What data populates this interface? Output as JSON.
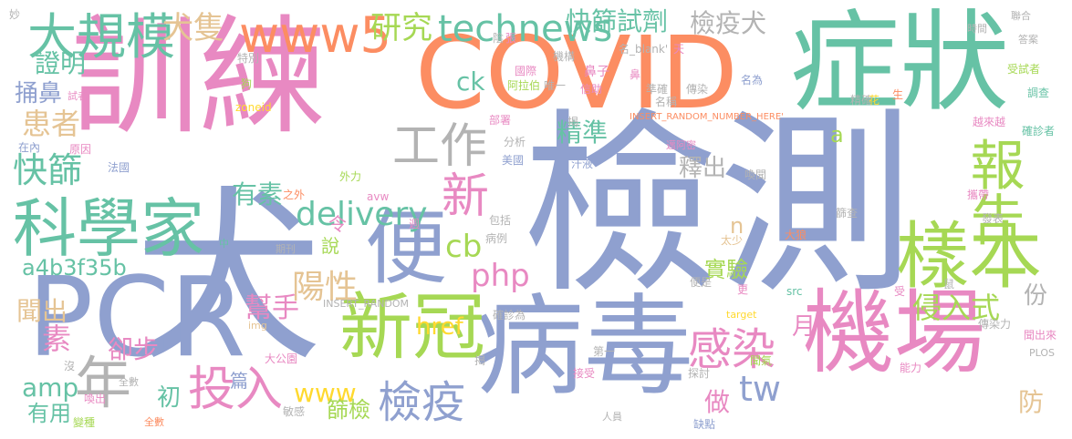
{
  "palette": {
    "pink": "#e889c2",
    "blue": "#8fa0cf",
    "orange": "#fc8d62",
    "green": "#66c2a5",
    "lime": "#a6d854",
    "yellow": "#ffd92f",
    "tan": "#e5c494",
    "gray": "#b3b3b3"
  },
  "words": [
    {
      "text": "檢測",
      "color": "blue"
    },
    {
      "text": "訓練",
      "color": "pink"
    },
    {
      "text": "犬",
      "color": "blue"
    },
    {
      "text": "COVID",
      "color": "orange"
    },
    {
      "text": "症狀",
      "color": "green"
    },
    {
      "text": "病毒",
      "color": "blue"
    },
    {
      "text": "機場",
      "color": "pink"
    },
    {
      "text": "PCR",
      "color": "blue"
    },
    {
      "text": "報告",
      "color": "lime"
    },
    {
      "text": "樣本",
      "color": "lime"
    },
    {
      "text": "科學家",
      "color": "green"
    },
    {
      "text": "便",
      "color": "blue"
    },
    {
      "text": "新冠",
      "color": "lime"
    },
    {
      "text": "大規模",
      "color": "green"
    },
    {
      "text": "www5",
      "color": "orange"
    },
    {
      "text": "工作",
      "color": "gray"
    },
    {
      "text": "年",
      "color": "gray"
    },
    {
      "text": "投入",
      "color": "pink"
    },
    {
      "text": "technews",
      "color": "green"
    },
    {
      "text": "研究",
      "color": "lime"
    },
    {
      "text": "快篩試劑",
      "color": "green"
    },
    {
      "text": "犬隻",
      "color": "tan"
    },
    {
      "text": "檢疫犬",
      "color": "gray"
    },
    {
      "text": "感染",
      "color": "pink"
    },
    {
      "text": "檢疫",
      "color": "blue"
    },
    {
      "text": "delivery",
      "color": "green"
    },
    {
      "text": "新",
      "color": "pink"
    },
    {
      "text": "php",
      "color": "pink"
    },
    {
      "text": "陽性",
      "color": "tan"
    },
    {
      "text": "快篩",
      "color": "green"
    },
    {
      "text": "患者",
      "color": "tan"
    },
    {
      "text": "證明",
      "color": "green"
    },
    {
      "text": "捅鼻",
      "color": "blue"
    },
    {
      "text": "ck",
      "color": "green"
    },
    {
      "text": "cb",
      "color": "lime"
    },
    {
      "text": "精準",
      "color": "green"
    },
    {
      "text": "釋出",
      "color": "gray"
    },
    {
      "text": "有素",
      "color": "green"
    },
    {
      "text": "a4b3f35b",
      "color": "green"
    },
    {
      "text": "amp",
      "color": "green"
    },
    {
      "text": "www",
      "color": "yellow"
    },
    {
      "text": "篩檢",
      "color": "lime"
    },
    {
      "text": "tw",
      "color": "blue"
    },
    {
      "text": "做",
      "color": "pink"
    },
    {
      "text": "侵入式",
      "color": "lime"
    },
    {
      "text": "實驗",
      "color": "lime"
    },
    {
      "text": "href",
      "color": "yellow"
    },
    {
      "text": "幫手",
      "color": "pink"
    },
    {
      "text": "聞出",
      "color": "tan"
    },
    {
      "text": "素",
      "color": "pink"
    },
    {
      "text": "卻步",
      "color": "pink"
    },
    {
      "text": "初",
      "color": "green"
    },
    {
      "text": "有用",
      "color": "green"
    },
    {
      "text": "月",
      "color": "pink"
    },
    {
      "text": "份",
      "color": "gray"
    },
    {
      "text": "說",
      "color": "lime"
    },
    {
      "text": "令",
      "color": "pink"
    },
    {
      "text": "n",
      "color": "tan"
    },
    {
      "text": "篇",
      "color": "blue"
    },
    {
      "text": "防",
      "color": "tan"
    },
    {
      "text": "a",
      "color": "lime"
    },
    {
      "text": "鼻子",
      "color": "pink"
    },
    {
      "text": "國際",
      "color": "pink"
    },
    {
      "text": "阿拉伯",
      "color": "lime"
    },
    {
      "text": "信助",
      "color": "pink"
    },
    {
      "text": "唯一",
      "color": "gray"
    },
    {
      "text": "名_blank'",
      "color": "gray"
    },
    {
      "text": "機構",
      "color": "gray"
    },
    {
      "text": "特別",
      "color": "gray"
    },
    {
      "text": "狗",
      "color": "lime"
    },
    {
      "text": "試者",
      "color": "pink"
    },
    {
      "text": "zoneid",
      "color": "yellow"
    },
    {
      "text": "在內",
      "color": "blue"
    },
    {
      "text": "原因",
      "color": "pink"
    },
    {
      "text": "法國",
      "color": "blue"
    },
    {
      "text": "部署",
      "color": "pink"
    },
    {
      "text": "分析",
      "color": "gray"
    },
    {
      "text": "美國",
      "color": "blue"
    },
    {
      "text": "汗液",
      "color": "blue"
    },
    {
      "text": "INSERT_RANDOM_NUMBER_HERE'",
      "color": "orange"
    },
    {
      "text": "邁阿密",
      "color": "pink"
    },
    {
      "text": "外力",
      "color": "lime"
    },
    {
      "text": "之外",
      "color": "orange"
    },
    {
      "text": "avw",
      "color": "pink"
    },
    {
      "text": "全數",
      "color": "gray"
    },
    {
      "text": "包括",
      "color": "gray"
    },
    {
      "text": "中",
      "color": "green"
    },
    {
      "text": "週",
      "color": "pink"
    },
    {
      "text": "期刊",
      "color": "gray"
    },
    {
      "text": "INSERT_RANDOM",
      "color": "gray"
    },
    {
      "text": "病例",
      "color": "gray"
    },
    {
      "text": "太少",
      "color": "tan"
    },
    {
      "text": "img",
      "color": "tan"
    },
    {
      "text": "確診為",
      "color": "gray"
    },
    {
      "text": "揭",
      "color": "gray"
    },
    {
      "text": "大公園",
      "color": "pink"
    },
    {
      "text": "沒",
      "color": "gray"
    },
    {
      "text": "第一",
      "color": "gray"
    },
    {
      "text": "接受",
      "color": "pink"
    },
    {
      "text": "喚出",
      "color": "pink"
    },
    {
      "text": "變種",
      "color": "lime"
    },
    {
      "text": "全數",
      "color": "orange"
    },
    {
      "text": "敏感",
      "color": "gray"
    },
    {
      "text": "人員",
      "color": "gray"
    },
    {
      "text": "時間",
      "color": "gray"
    },
    {
      "text": "聯合",
      "color": "gray"
    },
    {
      "text": "答案",
      "color": "gray"
    },
    {
      "text": "受試者",
      "color": "lime"
    },
    {
      "text": "調查",
      "color": "green"
    },
    {
      "text": "名為",
      "color": "blue"
    },
    {
      "text": "傳染",
      "color": "gray"
    },
    {
      "text": "準確",
      "color": "gray"
    },
    {
      "text": "精確",
      "color": "gray"
    },
    {
      "text": "越來越",
      "color": "pink"
    },
    {
      "text": "確診者",
      "color": "green"
    },
    {
      "text": "花",
      "color": "yellow"
    },
    {
      "text": "生",
      "color": "orange"
    },
    {
      "text": "喚聞",
      "color": "gray"
    },
    {
      "text": "攜帶",
      "color": "pink"
    },
    {
      "text": "發表",
      "color": "gray"
    },
    {
      "text": "大狼",
      "color": "orange"
    },
    {
      "text": "篩查",
      "color": "gray"
    },
    {
      "text": "便是",
      "color": "gray"
    },
    {
      "text": "受",
      "color": "pink"
    },
    {
      "text": "更",
      "color": "pink"
    },
    {
      "text": "src",
      "color": "green"
    },
    {
      "text": "target",
      "color": "yellow"
    },
    {
      "text": "傳染力",
      "color": "gray"
    },
    {
      "text": "聞出來",
      "color": "pink"
    },
    {
      "text": "PLOS",
      "color": "gray"
    },
    {
      "text": "能力",
      "color": "pink"
    },
    {
      "text": "聞氣",
      "color": "lime"
    },
    {
      "text": "揭",
      "color": "gray"
    },
    {
      "text": "缺點",
      "color": "blue"
    },
    {
      "text": "探討",
      "color": "gray"
    },
    {
      "text": "鼠",
      "color": "gray"
    },
    {
      "text": "名稱",
      "color": "gray"
    },
    {
      "text": "鼻",
      "color": "pink"
    },
    {
      "text": "天",
      "color": "pink"
    },
    {
      "text": "張",
      "color": "pink"
    },
    {
      "text": "陰",
      "color": "gray"
    },
    {
      "text": "妙",
      "color": "gray"
    }
  ]
}
